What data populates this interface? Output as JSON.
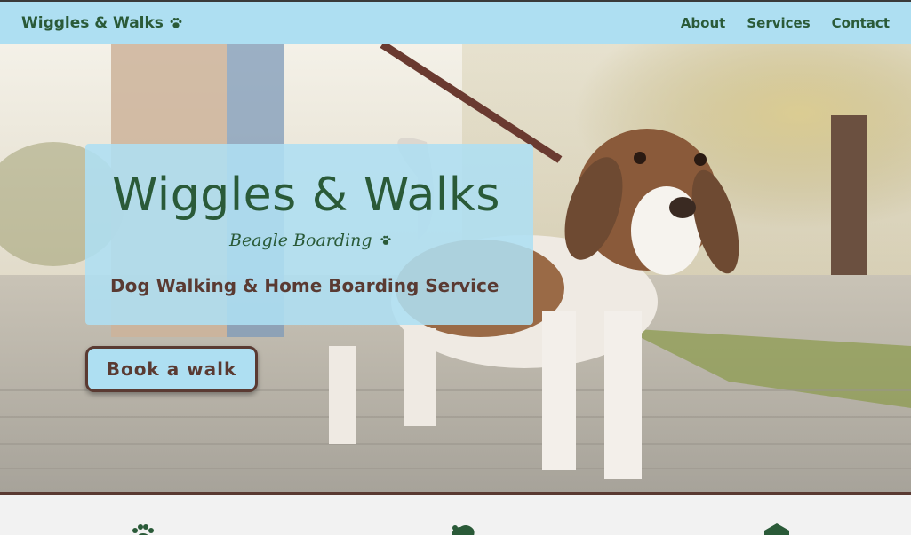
{
  "navbar": {
    "brand": "Wiggles & Walks",
    "brand_icon": "paw-icon",
    "links": [
      "About",
      "Services",
      "Contact"
    ]
  },
  "hero": {
    "title": "Wiggles & Walks",
    "subtitle": "Beagle Boarding",
    "subtitle_icon": "paw-icon",
    "tagline": "Dog Walking & Home Boarding Service",
    "cta": "Book a walk"
  },
  "features": {
    "icons": [
      "paw-icon",
      "dog-icon",
      "house-icon"
    ]
  },
  "colors": {
    "nav_bg": "#aedff2",
    "brand_green": "#2a5a38",
    "accent_brown": "#5a3a32"
  }
}
